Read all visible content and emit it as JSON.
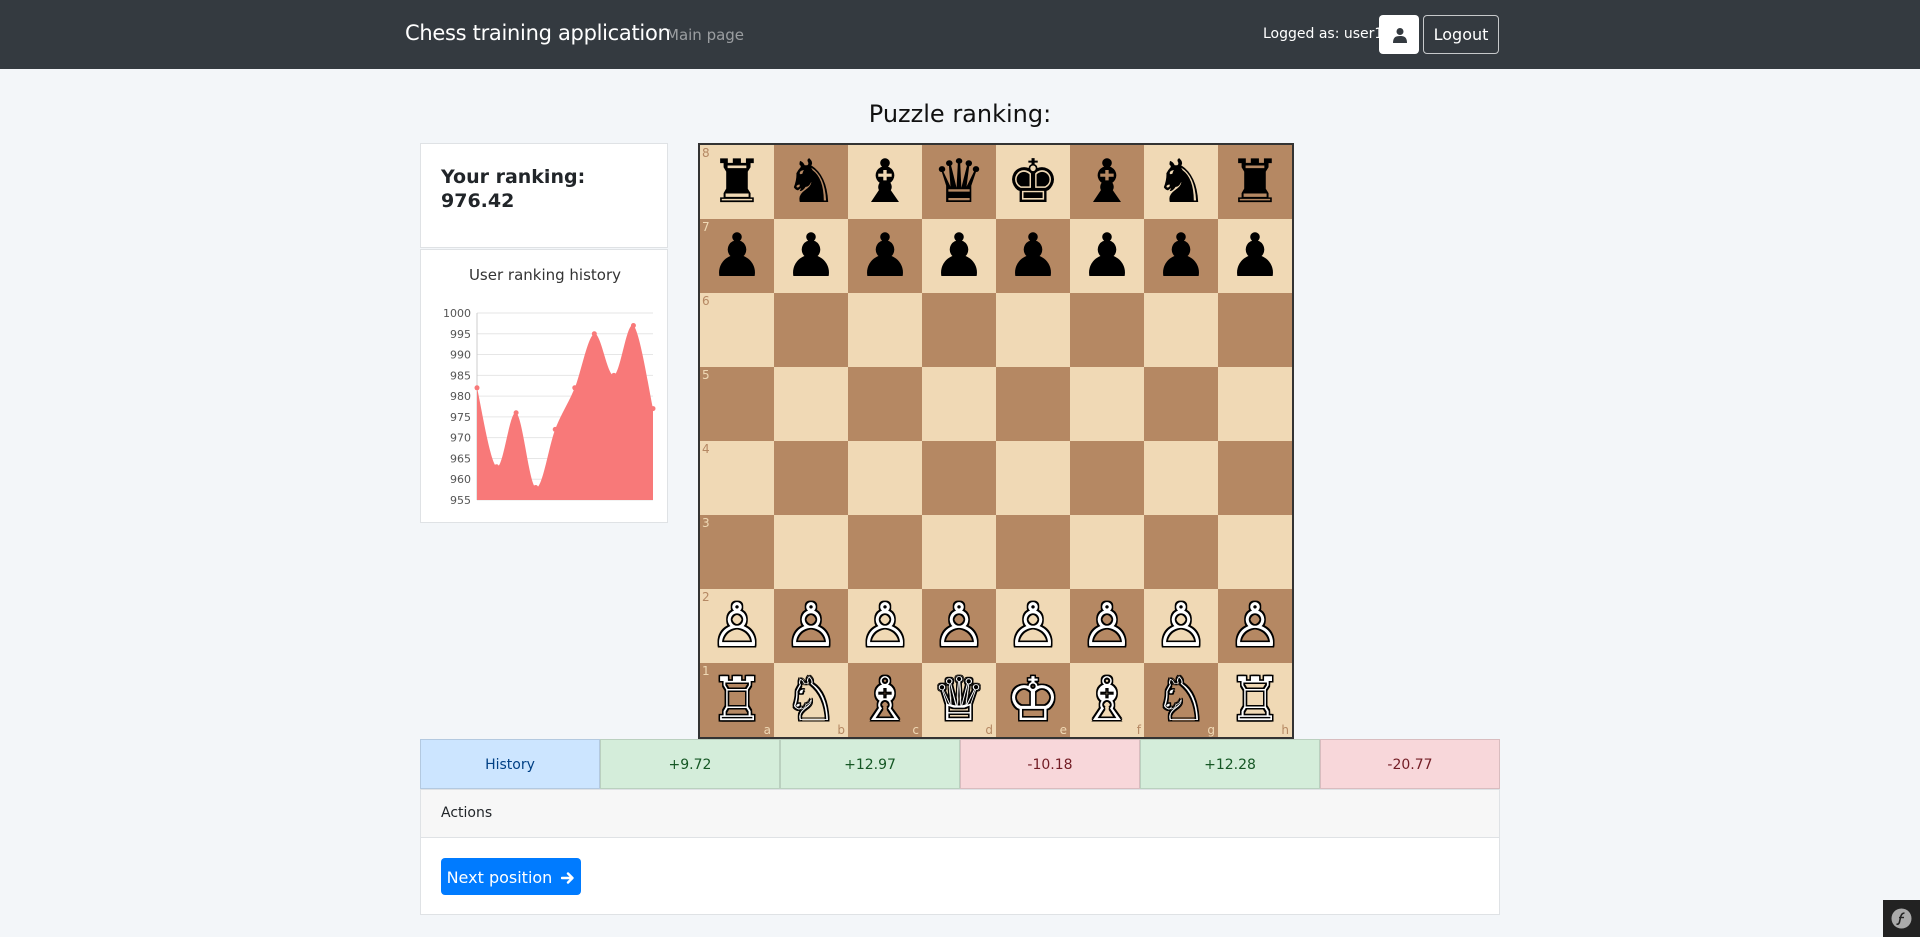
{
  "navbar": {
    "brand": "Chess training application",
    "main_link": "Main page",
    "logged_as": "Logged as: user1",
    "user_icon": "user-icon",
    "logout_label": "Logout"
  },
  "page": {
    "title": "Puzzle ranking:"
  },
  "ranking": {
    "label": "Your ranking:",
    "value": "976.42"
  },
  "chart_data": {
    "type": "area",
    "title": "User ranking history",
    "xlabel": "",
    "ylabel": "",
    "ylim": [
      955,
      1000
    ],
    "yticks": [
      1000,
      995,
      990,
      985,
      980,
      975,
      970,
      965,
      960,
      955
    ],
    "grid": true,
    "color": "#f87979",
    "series": [
      {
        "values": [
          982,
          963,
          976,
          958,
          972,
          982,
          995,
          985,
          997,
          977
        ]
      }
    ]
  },
  "board": {
    "ranks": [
      "8",
      "7",
      "6",
      "5",
      "4",
      "3",
      "2",
      "1"
    ],
    "files": [
      "a",
      "b",
      "c",
      "d",
      "e",
      "f",
      "g",
      "h"
    ],
    "light_color": "#f0d9b5",
    "dark_color": "#b58863",
    "position": [
      [
        "♜",
        "♞",
        "♝",
        "♛",
        "♚",
        "♝",
        "♞",
        "♜"
      ],
      [
        "♟",
        "♟",
        "♟",
        "♟",
        "♟",
        "♟",
        "♟",
        "♟"
      ],
      [
        "",
        "",
        "",
        "",
        "",
        "",
        "",
        ""
      ],
      [
        "",
        "",
        "",
        "",
        "",
        "",
        "",
        ""
      ],
      [
        "",
        "",
        "",
        "",
        "",
        "",
        "",
        ""
      ],
      [
        "",
        "",
        "",
        "",
        "",
        "",
        "",
        ""
      ],
      [
        "♙",
        "♙",
        "♙",
        "♙",
        "♙",
        "♙",
        "♙",
        "♙"
      ],
      [
        "♖",
        "♘",
        "♗",
        "♕",
        "♔",
        "♗",
        "♘",
        "♖"
      ]
    ],
    "piece_colors": [
      [
        "black",
        "black",
        "black",
        "black",
        "black",
        "black",
        "black",
        "black"
      ],
      [
        "black",
        "black",
        "black",
        "black",
        "black",
        "black",
        "black",
        "black"
      ],
      [
        "",
        "",
        "",
        "",
        "",
        "",
        "",
        ""
      ],
      [
        "",
        "",
        "",
        "",
        "",
        "",
        "",
        ""
      ],
      [
        "",
        "",
        "",
        "",
        "",
        "",
        "",
        ""
      ],
      [
        "",
        "",
        "",
        "",
        "",
        "",
        "",
        ""
      ],
      [
        "white",
        "white",
        "white",
        "white",
        "white",
        "white",
        "white",
        "white"
      ],
      [
        "white",
        "white",
        "white",
        "white",
        "white",
        "white",
        "white",
        "white"
      ]
    ]
  },
  "history": {
    "label": "History",
    "entries": [
      {
        "value": "+9.72",
        "status": "positive"
      },
      {
        "value": "+12.97",
        "status": "positive"
      },
      {
        "value": "-10.18",
        "status": "negative"
      },
      {
        "value": "+12.28",
        "status": "positive"
      },
      {
        "value": "-20.77",
        "status": "negative"
      }
    ]
  },
  "actions": {
    "title": "Actions",
    "next_label": "Next position",
    "next_icon": "arrow-right-icon"
  },
  "footer": {
    "badge_icon": "symfony-icon"
  }
}
